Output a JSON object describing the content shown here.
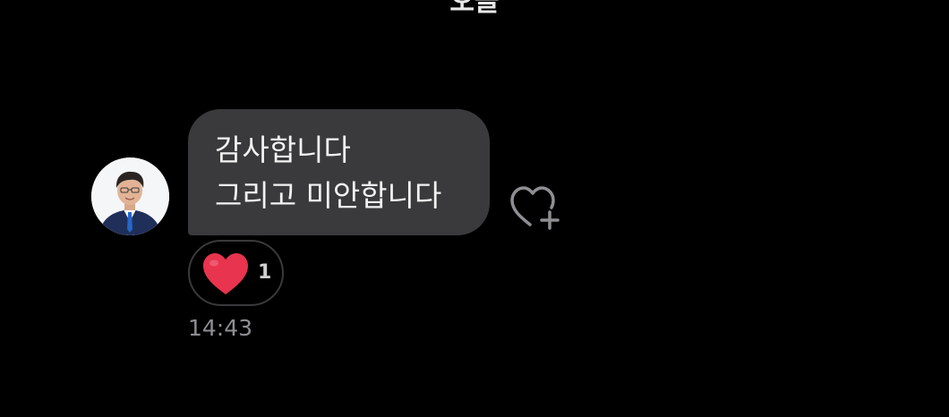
{
  "date_divider": "오늘",
  "message": {
    "lines": [
      "감사합니다",
      "그리고 미안합니다"
    ],
    "timestamp": "14:43"
  },
  "reaction": {
    "emoji_icon": "red-heart-icon",
    "count": "1"
  },
  "actions": {
    "add_reaction_icon": "heart-plus-icon"
  },
  "colors": {
    "background": "#000000",
    "bubble": "#3a3a3c",
    "heart": "#e8344e",
    "timestamp": "#8e8e93"
  }
}
